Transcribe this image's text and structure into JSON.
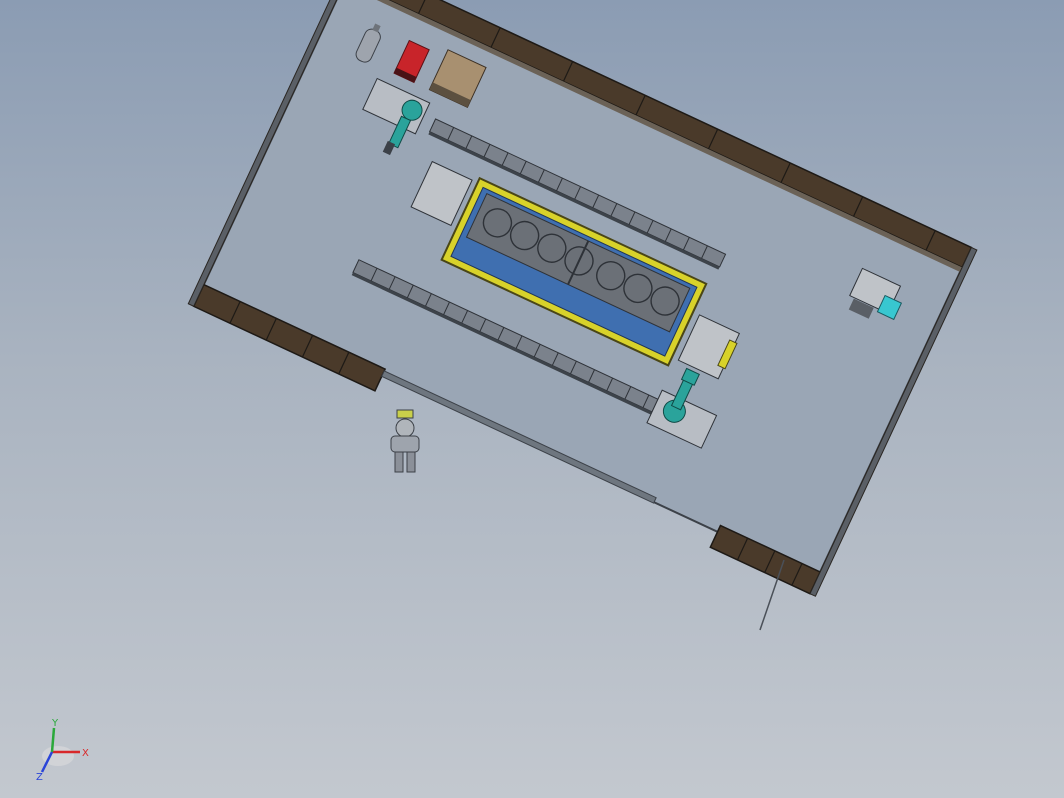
{
  "viewport": {
    "background_top": "#8b9cb3",
    "background_bottom": "#c3c8cf"
  },
  "colors": {
    "frame_dark": "#4a3a2a",
    "frame_edge": "#2a2622",
    "floor": "#9aa6b5",
    "rail": "#5d6570",
    "robot_teal": "#2aa39b",
    "fixture_yellow": "#d8d22a",
    "fixture_blue": "#3f6fb0",
    "tank_red": "#c8242a",
    "cabinet_tan": "#a89070",
    "cabinet_grey": "#bfc3c8",
    "accent_cyan": "#38c7d0"
  },
  "triad": {
    "x_label": "X",
    "y_label": "Y",
    "z_label": "Z",
    "x_color": "#d8282a",
    "y_color": "#2aa83a",
    "z_color": "#2a44d8"
  }
}
